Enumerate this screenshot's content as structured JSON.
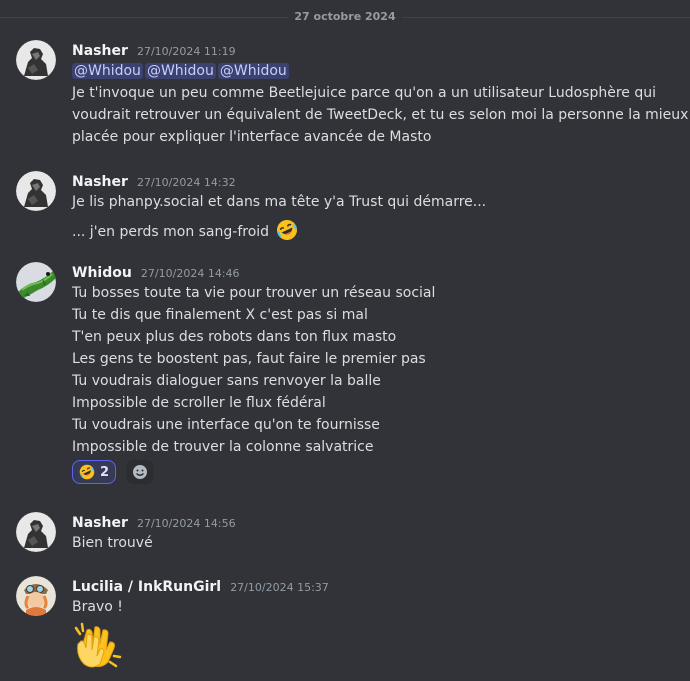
{
  "date_divider": "27 octobre 2024",
  "messages": [
    {
      "author": "Nasher",
      "timestamp": "27/10/2024 11:19",
      "mentions": [
        "@Whidou",
        "@Whidou",
        "@Whidou"
      ],
      "lines": [
        "Je t'invoque un peu comme Beetlejuice parce qu'on a un utilisateur Ludosphère qui",
        "voudrait retrouver un équivalent de TweetDeck, et tu es selon moi la personne la mieux",
        "placée pour expliquer l'interface avancée de Masto"
      ]
    },
    {
      "author": "Nasher",
      "timestamp": "27/10/2024 14:32",
      "lines": [
        "Je lis phanpy.social et dans ma tête y'a Trust qui démarre...",
        "... j'en perds mon sang-froid"
      ],
      "emoji": "rofl-emoji"
    },
    {
      "author": "Whidou",
      "timestamp": "27/10/2024 14:46",
      "lines": [
        "Tu bosses toute ta vie pour trouver un réseau social",
        "Tu te dis que finalement X c'est pas si mal",
        "T'en peux plus des robots dans ton flux masto",
        "Les gens te boostent pas, faut faire le premier pas",
        "Tu voudrais dialoguer sans renvoyer la balle",
        "Impossible de scroller le flux fédéral",
        "Tu voudrais une interface qu'on te fournisse",
        "Impossible de trouver la colonne salvatrice"
      ],
      "reaction": {
        "emoji": "rofl-emoji",
        "count": "2"
      }
    },
    {
      "author": "Nasher",
      "timestamp": "27/10/2024 14:56",
      "lines": [
        "Bien trouvé"
      ]
    },
    {
      "author": "Lucilia / InkRunGirl",
      "timestamp": "27/10/2024 15:37",
      "lines": [
        "Bravo !"
      ],
      "emoji": "clapping-hands-emoji"
    }
  ],
  "icons": {
    "add_reaction": "smiley-add-reaction-icon",
    "rofl": "rofl-emoji",
    "clap": "clapping-hands-emoji"
  },
  "colors": {
    "background": "#313338",
    "mention_bg": "#3c4270",
    "mention_text": "#c9cdfb",
    "reaction_border": "#5865f2"
  }
}
